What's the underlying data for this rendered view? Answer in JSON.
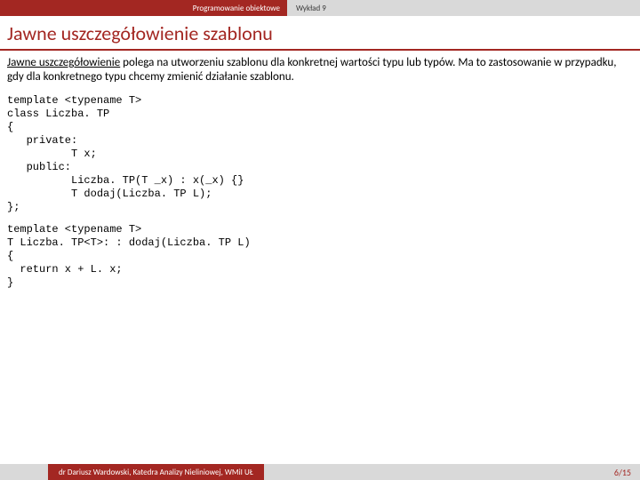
{
  "header": {
    "course": "Programowanie obiektowe",
    "lecture": "Wykład 9"
  },
  "title": "Jawne uszczegółowienie szablonu",
  "paragraph": {
    "underlined": "Jawne uszczegółowienie",
    "rest": " polega na utworzeniu szablonu dla konkretnej wartości typu lub typów. Ma to zastosowanie w przypadku, gdy dla konkretnego typu chcemy zmienić działanie szablonu."
  },
  "code1": "template <typename T>\nclass Liczba. TP\n{\n   private:\n          T x;\n   public:\n          Liczba. TP(T _x) : x(_x) {}\n          T dodaj(Liczba. TP L);\n};",
  "code2": "template <typename T>\nT Liczba. TP<T>: : dodaj(Liczba. TP L)\n{\n  return x + L. x;\n}",
  "footer": {
    "author": "dr Dariusz Wardowski, Katedra Analizy Nieliniowej, WMiI UŁ",
    "page": "6/15"
  }
}
